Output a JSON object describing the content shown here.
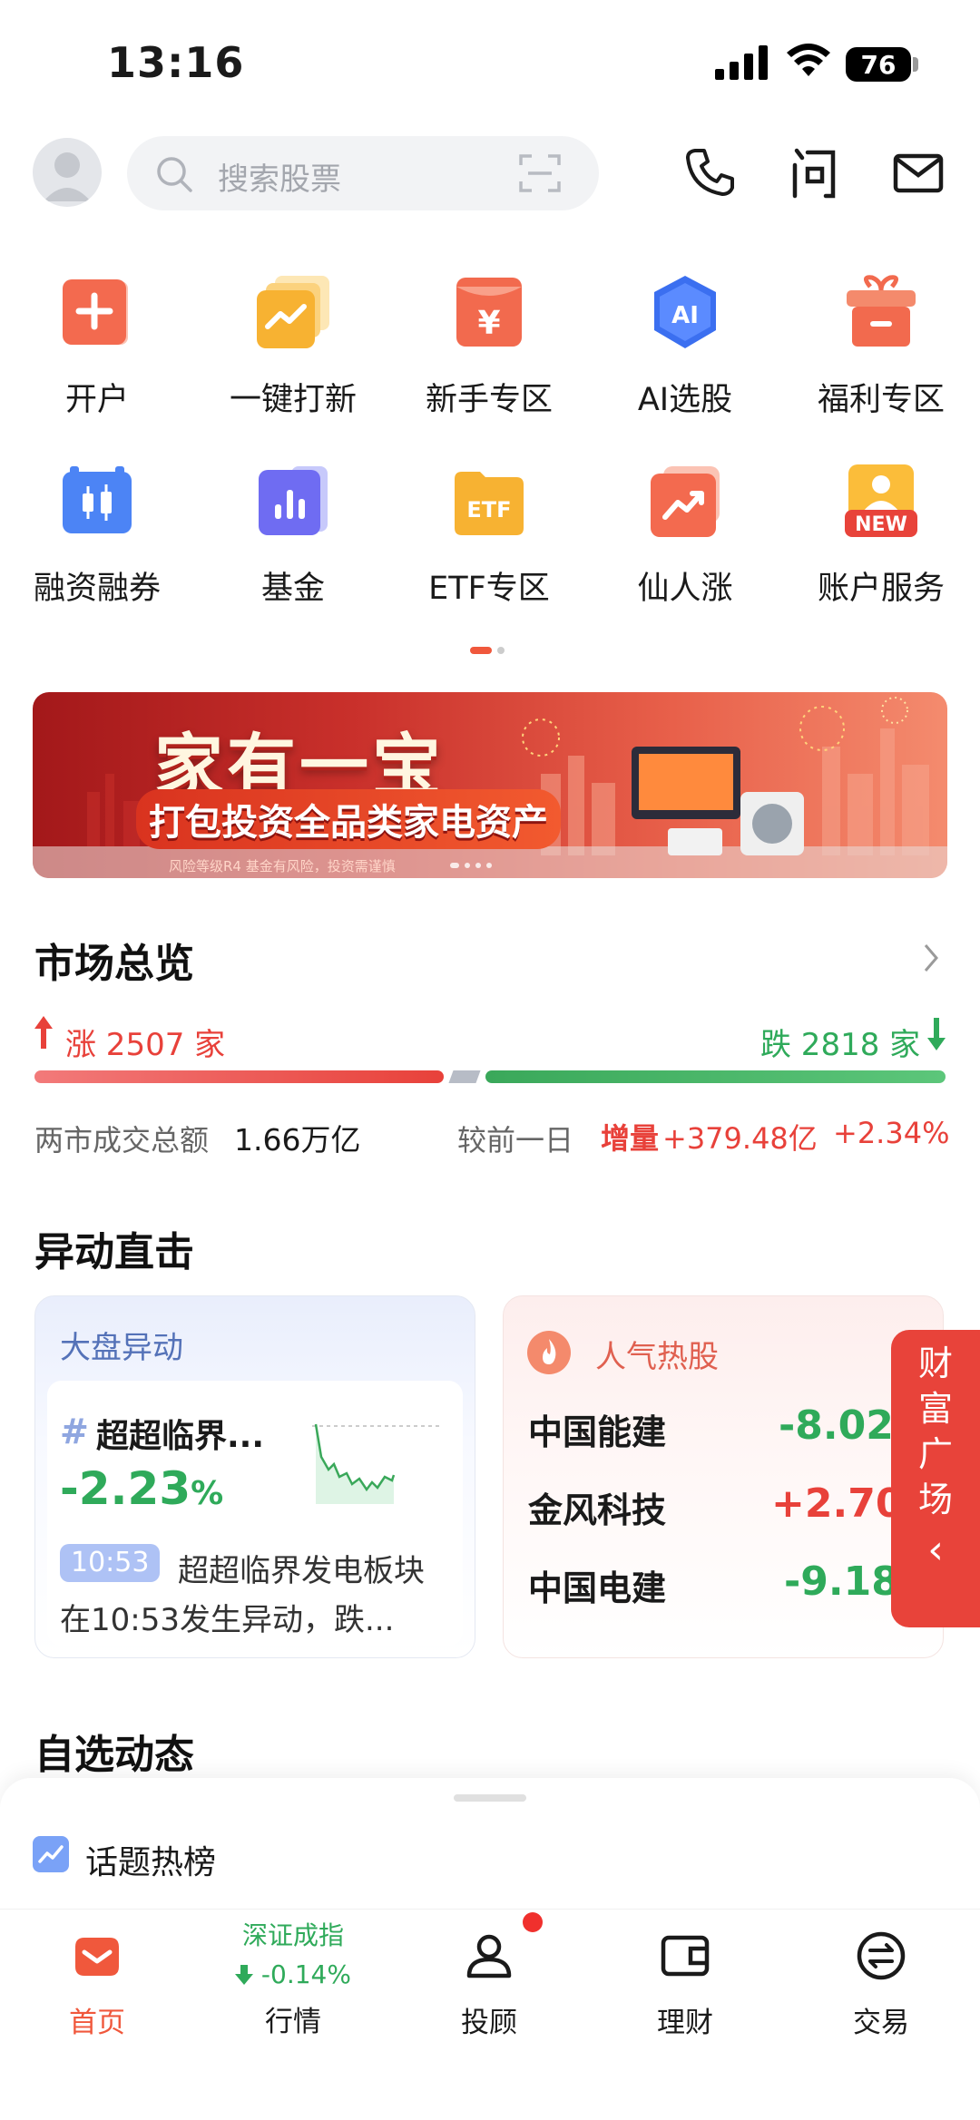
{
  "status_bar": {
    "time": "13:16",
    "battery": "76"
  },
  "header": {
    "search_placeholder": "搜索股票"
  },
  "shortcuts_row1": [
    {
      "label": "开户",
      "icon": "plus-card-icon"
    },
    {
      "label": "一键打新",
      "icon": "trend-cards-icon"
    },
    {
      "label": "新手专区",
      "icon": "yen-envelope-icon"
    },
    {
      "label": "AI选股",
      "icon": "ai-shield-icon"
    },
    {
      "label": "福利专区",
      "icon": "gift-box-icon"
    }
  ],
  "shortcuts_row2": [
    {
      "label": "融资融券",
      "icon": "candlestick-icon"
    },
    {
      "label": "基金",
      "icon": "bar-chart-icon"
    },
    {
      "label": "ETF专区",
      "icon": "etf-folder-icon"
    },
    {
      "label": "仙人涨",
      "icon": "rising-arrow-icon"
    },
    {
      "label": "账户服务",
      "icon": "account-new-icon",
      "badge": "NEW"
    }
  ],
  "banner": {
    "title": "家有一宝",
    "subtitle": "打包投资全品类家电资产",
    "note": "风险等级R4 基金有风险，投资需谨慎"
  },
  "market": {
    "title": "市场总览",
    "rise_label": "涨 2507 家",
    "fall_label": "跌 2818 家",
    "rise_count": 2507,
    "fall_count": 2818,
    "turnover_label": "两市成交总额",
    "turnover_value": "1.66万亿",
    "compare_label": "较前一日",
    "increase_label": "增量",
    "increase_value": "+379.48亿",
    "increase_pct": "+2.34%"
  },
  "movers": {
    "title": "异动直击",
    "card1": {
      "title": "大盘异动",
      "hash": "#",
      "topic": "超超临界...",
      "change": "-2.23",
      "pct_sign": "%",
      "time_tag": "10:53",
      "desc_line1": "超超临界发电板块",
      "desc_line2": "在10:53发生异动，跌..."
    },
    "card2": {
      "title": "人气热股",
      "stocks": [
        {
          "name": "中国能建",
          "change": "-8.02"
        },
        {
          "name": "金风科技",
          "change": "+2.70"
        },
        {
          "name": "中国电建",
          "change": "-9.18"
        }
      ]
    }
  },
  "float_tab": {
    "chars": [
      "财",
      "富",
      "广",
      "场"
    ],
    "arrow": "‹"
  },
  "watchlist": {
    "title": "自选动态"
  },
  "sheet": {
    "topic_label": "话题热榜"
  },
  "tabbar": {
    "home": "首页",
    "index_name": "深证成指",
    "index_change": "-0.14%",
    "market": "行情",
    "advisor": "投顾",
    "wealth": "理财",
    "trade": "交易"
  },
  "colors": {
    "accent": "#f0583c",
    "up": "#e8413a",
    "down": "#2faa5a"
  }
}
